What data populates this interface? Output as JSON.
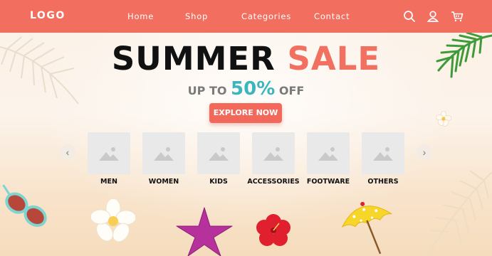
{
  "header": {
    "logo": "LOGO",
    "nav": [
      "Home",
      "Shop",
      "Categories",
      "Contact"
    ],
    "icons": [
      "search-icon",
      "user-icon",
      "cart-icon"
    ]
  },
  "hero": {
    "title_word1": "SUMMER",
    "title_word2": "SALE",
    "subtitle_prefix": "UP TO",
    "subtitle_value": "50%",
    "subtitle_suffix": "OFF",
    "cta": "EXPLORE NOW"
  },
  "categories": [
    "MEN",
    "WOMEN",
    "KIDS",
    "ACCESSORIES",
    "FOOTWARE",
    "OTHERS"
  ],
  "colors": {
    "accent": "#f26f5f",
    "highlight": "#3bb6bd",
    "title": "#111111"
  }
}
